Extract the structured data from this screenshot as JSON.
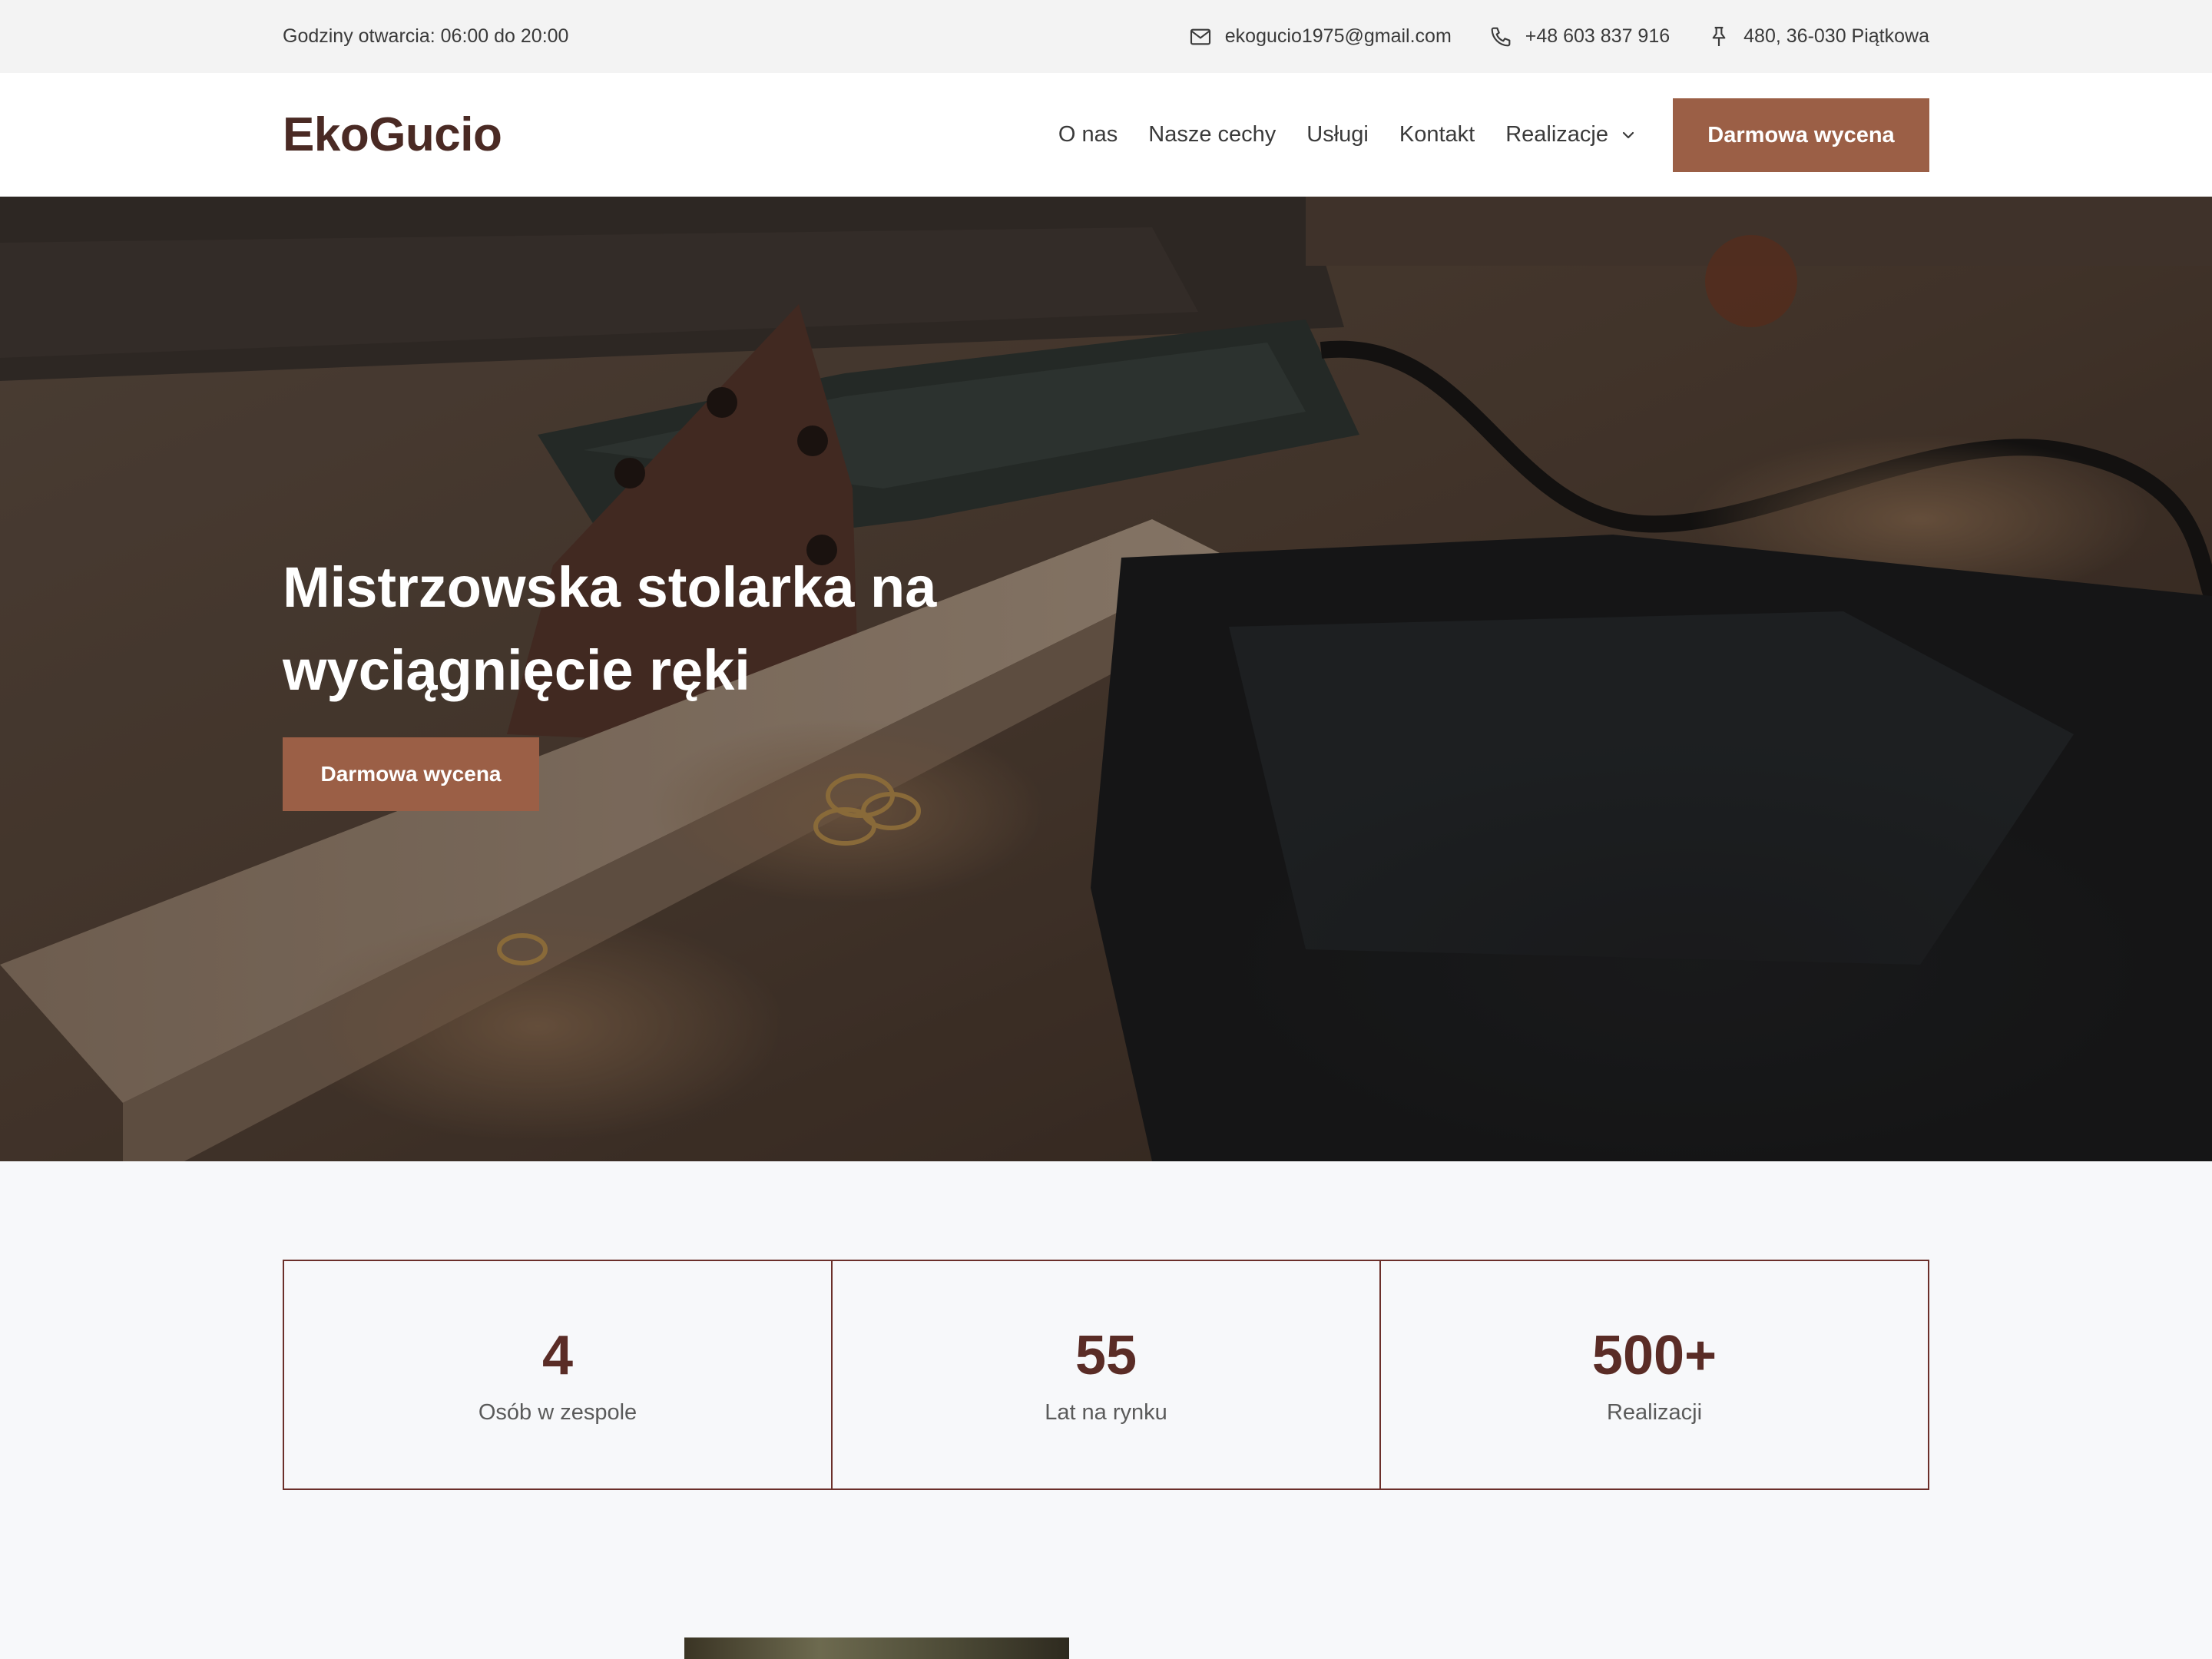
{
  "topbar": {
    "hours": "Godziny otwarcia: 06:00 do 20:00",
    "email": "ekogucio1975@gmail.com",
    "phone": "+48 603 837 916",
    "address": "480, 36-030 Piątkowa",
    "icons": [
      "mail-icon",
      "phone-icon",
      "pin-icon"
    ]
  },
  "header": {
    "logo": "EkoGucio",
    "nav": [
      {
        "label": "O nas"
      },
      {
        "label": "Nasze cechy"
      },
      {
        "label": "Usługi"
      },
      {
        "label": "Kontakt"
      },
      {
        "label": "Realizacje"
      }
    ],
    "cta": "Darmowa wycena"
  },
  "hero": {
    "title": "Mistrzowska stolarka na wyciągnięcie ręki",
    "cta": "Darmowa wycena"
  },
  "stats": [
    {
      "value": "4",
      "label": "Osób w zespole"
    },
    {
      "value": "55",
      "label": "Lat na rynku"
    },
    {
      "value": "500+",
      "label": "Realizacji"
    }
  ],
  "colors": {
    "accent": "#9b5f46",
    "brand_dark": "#4a2a24",
    "stat_border": "#6b2f2a",
    "topbar_bg": "#f3f3f3",
    "page_bg": "#f7f8fa"
  }
}
